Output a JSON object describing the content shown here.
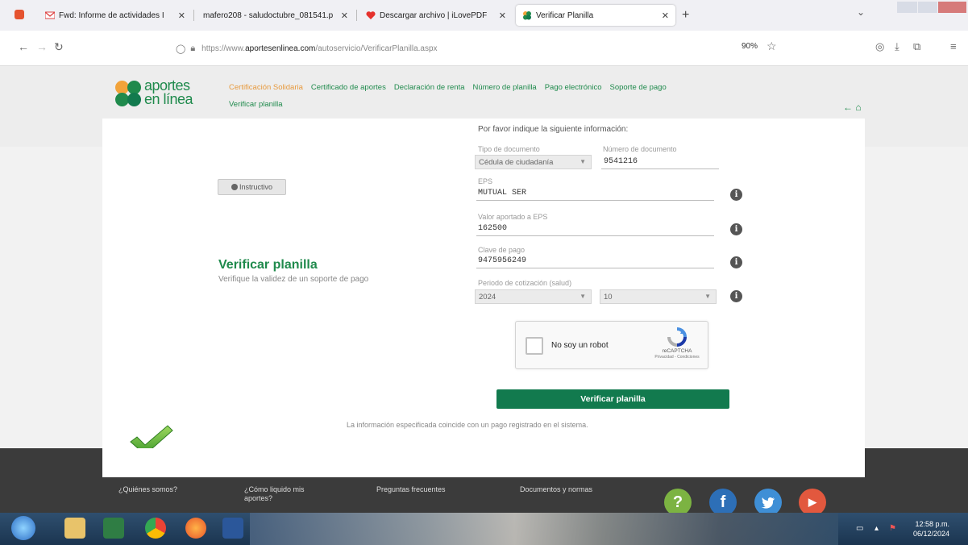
{
  "browser": {
    "tabs": [
      {
        "title": "Fwd: Informe de actividades I",
        "close": "✕"
      },
      {
        "title": "mafero208 - saludoctubre_081541.p",
        "close": "✕"
      },
      {
        "title": "Descargar archivo | iLovePDF",
        "close": "✕"
      },
      {
        "title": "Verificar Planilla",
        "close": "✕"
      }
    ],
    "new_tab": "+",
    "url_base": "https://www.",
    "url_domain": "aportesenlinea.com",
    "url_path": "/autoservicio/VerificarPlanilla.aspx",
    "zoom": "90%"
  },
  "site": {
    "logo_line1": "aportes",
    "logo_line2": "en línea",
    "nav": [
      "Certificación Solidaria",
      "Certificado de aportes",
      "Declaración de renta",
      "Número de planilla",
      "Pago electrónico",
      "Soporte de pago"
    ],
    "nav_row2": "Verificar planilla",
    "side_arrows": "← ⌂"
  },
  "main": {
    "instructivo": "Instructivo",
    "title": "Verificar planilla",
    "subtitle": "Verifique la validez de un soporte de pago",
    "form_heading": "Por favor indique la siguiente información:",
    "fields": {
      "tipo_doc_label": "Tipo de documento",
      "tipo_doc_value": "Cédula de ciudadanía",
      "num_doc_label": "Número de documento",
      "num_doc_value": "9541216",
      "eps_label": "EPS",
      "eps_value": "MUTUAL SER",
      "valor_label": "Valor aportado a EPS",
      "valor_value": "162500",
      "clave_label": "Clave de pago",
      "clave_value": "9475956249",
      "periodo_label": "Periodo de cotización (salud)",
      "periodo_year": "2024",
      "periodo_month": "10"
    },
    "captcha": {
      "label": "No soy un robot",
      "brand": "reCAPTCHA",
      "links": "Privacidad - Condiciones"
    },
    "verify_button": "Verificar planilla",
    "result_message": "La información especificada coincide con un pago registrado en el sistema."
  },
  "footer": {
    "links": [
      "¿Quiénes somos?",
      "¿Cómo liquido mis aportes?",
      "Preguntas frecuentes",
      "Documentos y normas"
    ],
    "social": [
      {
        "name": "help",
        "glyph": "?",
        "color": "#7cb342"
      },
      {
        "name": "facebook",
        "glyph": "f",
        "color": "#2d6fb7"
      },
      {
        "name": "twitter",
        "glyph": "t",
        "color": "#3f8fd6"
      },
      {
        "name": "youtube",
        "glyph": "▶",
        "color": "#e2583e"
      }
    ]
  },
  "taskbar": {
    "time": "12:58 p.m.",
    "date": "06/12/2024"
  }
}
